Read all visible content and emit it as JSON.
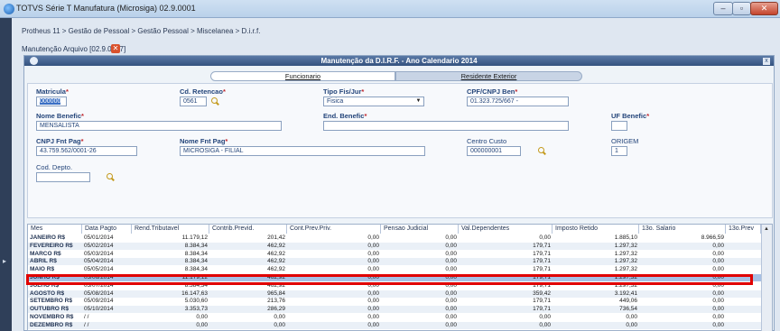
{
  "window": {
    "title": "TOTVS Série T Manufatura (Microsiga) 02.9.0001"
  },
  "breadcrumb": "Protheus 11 > Gestão de Pessoal > Gestão Pessoal > Miscelanea > D.i.r.f.",
  "subwindow": {
    "title": "Manutenção Arquivo [02.9.0007]",
    "close": "✕"
  },
  "dialog": {
    "title": "Manutenção da D.I.R.F. - Ano Calendario 2014",
    "close": "x"
  },
  "tabs": [
    {
      "label": "Funcionario"
    },
    {
      "label": "Residente Exterior"
    }
  ],
  "form": {
    "matricula": {
      "label": "Matricula",
      "value": "000000"
    },
    "cd_retencao": {
      "label": "Cd. Retencao",
      "value": "0561"
    },
    "tipo_fis_jur": {
      "label": "Tipo Fis/Jur",
      "value": "Fisica"
    },
    "cpf_cnpj_ben": {
      "label": "CPF/CNPJ Ben",
      "value": "01.323.725/667 -"
    },
    "nome_benefic": {
      "label": "Nome Benefic",
      "value": "MENSALISTA"
    },
    "end_benefic": {
      "label": "End. Benefic",
      "value": ""
    },
    "uf_benefic": {
      "label": "UF Benefic",
      "value": ""
    },
    "cnpj_fnt_pag": {
      "label": "CNPJ Fnt Pag",
      "value": "43.759.562/0001-26"
    },
    "nome_fnt_pag": {
      "label": "Nome Fnt Pag",
      "value": "MICROSIGA - FILIAL"
    },
    "centro_custo": {
      "label": "Centro Custo",
      "value": "000000001"
    },
    "origem": {
      "label": "ORIGEM",
      "value": "1"
    },
    "cod_depto": {
      "label": "Cod. Depto.",
      "value": ""
    }
  },
  "grid": {
    "columns": [
      "Mes",
      "Data Pagto",
      "Rend.Tributavel",
      "Contrib.Previd.",
      "Cont.Prev.Priv.",
      "Pensao Judicial",
      "Val.Dependentes",
      "Imposto Retido",
      "13o. Salario",
      "13o.Prev"
    ],
    "rows": [
      [
        "JANEIRO R$",
        "05/01/2014",
        "11.179,12",
        "201,42",
        "0,00",
        "0,00",
        "0,00",
        "1.885,10",
        "8.966,59"
      ],
      [
        "FEVEREIRO R$",
        "05/02/2014",
        "8.384,34",
        "462,92",
        "0,00",
        "0,00",
        "179,71",
        "1.297,32",
        "0,00"
      ],
      [
        "MARCO R$",
        "05/03/2014",
        "8.384,34",
        "462,92",
        "0,00",
        "0,00",
        "179,71",
        "1.297,32",
        "0,00"
      ],
      [
        "ABRIL R$",
        "05/04/2014",
        "8.384,34",
        "462,92",
        "0,00",
        "0,00",
        "179,71",
        "1.297,32",
        "0,00"
      ],
      [
        "MAIO R$",
        "05/05/2014",
        "8.384,34",
        "462,92",
        "0,00",
        "0,00",
        "179,71",
        "1.297,32",
        "0,00"
      ],
      [
        "JUNHO R$",
        "05/06/2014",
        "11.179,12",
        "462,92",
        "0,00",
        "0,00",
        "179,71",
        "1.297,32",
        "0,00"
      ],
      [
        "JULHO R$",
        "05/07/2014",
        "8.384,34",
        "462,92",
        "0,00",
        "0,00",
        "179,71",
        "1.297,32",
        "0,00"
      ],
      [
        "AGOSTO R$",
        "05/08/2014",
        "16.147,63",
        "965,84",
        "0,00",
        "0,00",
        "359,42",
        "3.192,41",
        "0,00"
      ],
      [
        "SETEMBRO R$",
        "05/09/2014",
        "5.030,60",
        "213,76",
        "0,00",
        "0,00",
        "179,71",
        "449,06",
        "0,00"
      ],
      [
        "OUTUBRO R$",
        "05/10/2014",
        "3.353,73",
        "286,29",
        "0,00",
        "0,00",
        "179,71",
        "736,54",
        "0,00"
      ],
      [
        "NOVEMBRO R$",
        "/ /",
        "0,00",
        "0,00",
        "0,00",
        "0,00",
        "0,00",
        "0,00",
        "0,00"
      ],
      [
        "DEZEMBRO R$",
        "/ /",
        "0,00",
        "0,00",
        "0,00",
        "0,00",
        "0,00",
        "0,00",
        "0,00"
      ]
    ],
    "selected_row": 5
  },
  "colors": {
    "header": "#34527f",
    "label": "#24457a",
    "required": "#c0262c",
    "highlight": "#e00000"
  }
}
